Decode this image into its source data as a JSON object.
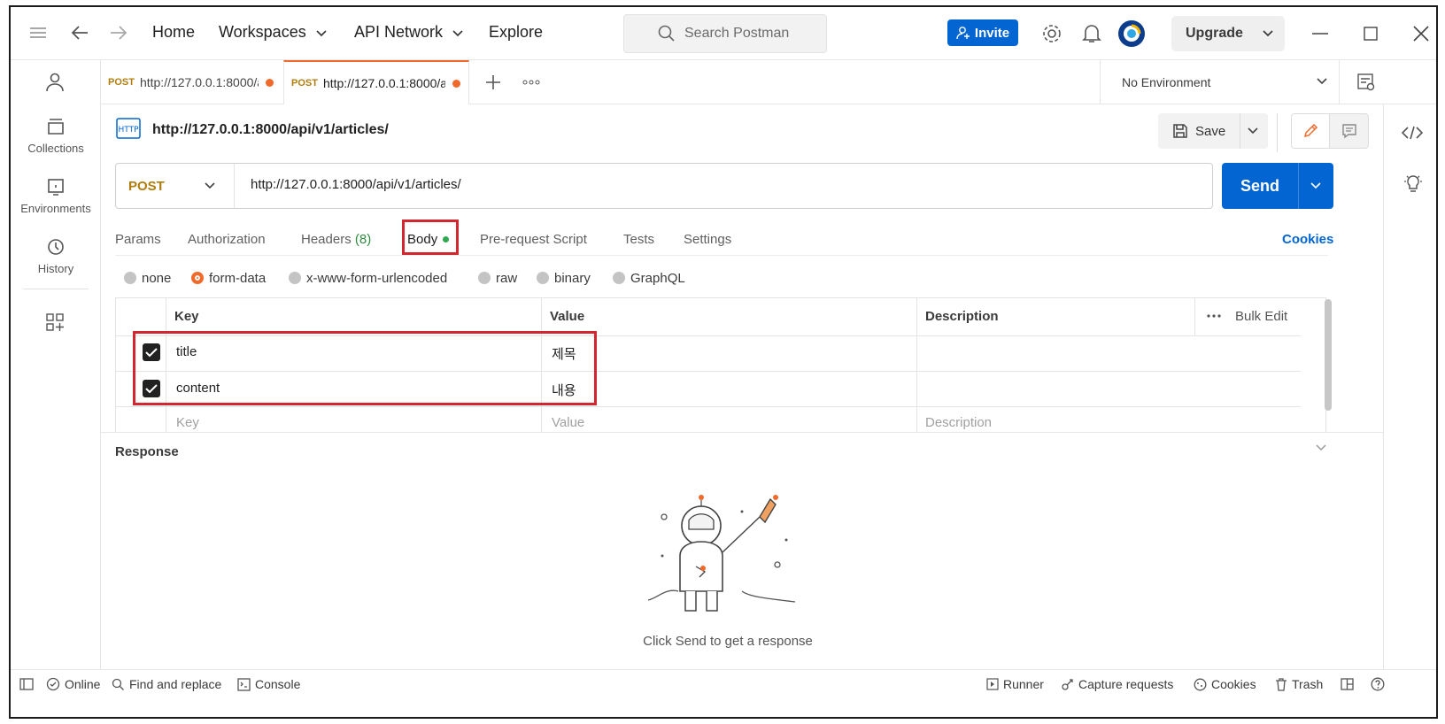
{
  "topbar": {
    "nav": [
      "Home",
      "Workspaces",
      "API Network",
      "Explore"
    ],
    "search_placeholder": "Search Postman",
    "invite_label": "Invite",
    "upgrade_label": "Upgrade"
  },
  "sidebar": {
    "items": [
      {
        "label": "Collections",
        "icon": "collections-icon"
      },
      {
        "label": "Environments",
        "icon": "environments-icon"
      },
      {
        "label": "History",
        "icon": "history-icon"
      }
    ]
  },
  "tabs": [
    {
      "method": "POST",
      "url": "http://127.0.0.1:8000/a",
      "unsaved": true,
      "active": false
    },
    {
      "method": "POST",
      "url": "http://127.0.0.1:8000/a",
      "unsaved": true,
      "active": true
    }
  ],
  "environment": {
    "selected": "No Environment"
  },
  "request": {
    "title": "http://127.0.0.1:8000/api/v1/articles/",
    "save_label": "Save",
    "method": "POST",
    "url": "http://127.0.0.1:8000/api/v1/articles/",
    "send_label": "Send",
    "subtabs": [
      "Params",
      "Authorization",
      "Headers",
      "(8)",
      "Body",
      "Pre-request Script",
      "Tests",
      "Settings"
    ],
    "cookies_label": "Cookies",
    "body_modes": [
      "none",
      "form-data",
      "x-www-form-urlencoded",
      "raw",
      "binary",
      "GraphQL"
    ],
    "body_mode_selected": "form-data"
  },
  "form_table": {
    "headers": [
      "Key",
      "Value",
      "Description"
    ],
    "bulk_edit_label": "Bulk Edit",
    "rows": [
      {
        "key": "title",
        "value": "제목",
        "checked": true
      },
      {
        "key": "content",
        "value": "내용",
        "checked": true
      }
    ],
    "empty_row": {
      "key": "Key",
      "value": "Value",
      "description": "Description"
    }
  },
  "response": {
    "label": "Response",
    "hint": "Click Send to get a response"
  },
  "statusbar": {
    "left": [
      "Online",
      "Find and replace",
      "Console"
    ],
    "right": [
      "Runner",
      "Capture requests",
      "Cookies",
      "Trash"
    ]
  },
  "colors": {
    "accent_blue": "#0265d2",
    "accent_orange": "#f06a2c",
    "highlight_red": "#d0282e",
    "method_post": "#b07d0c"
  }
}
